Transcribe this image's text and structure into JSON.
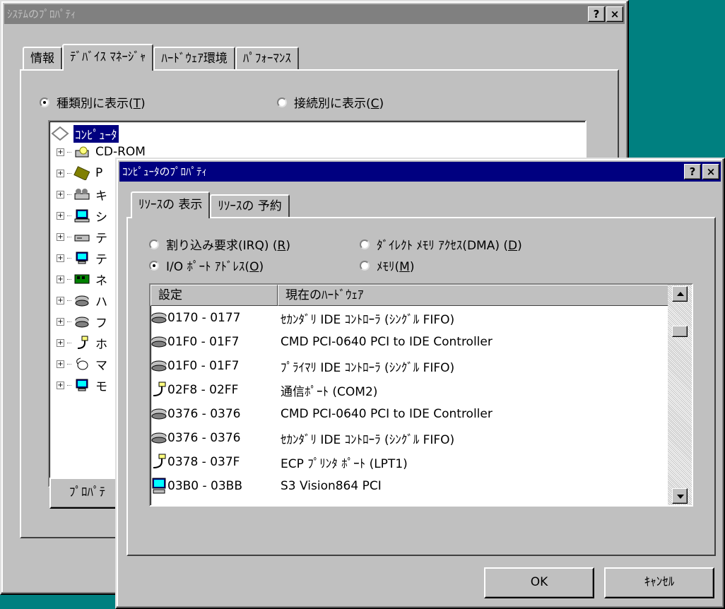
{
  "back_window": {
    "title": "ｼｽﾃﾑのﾌﾟﾛﾊﾟﾃｨ",
    "help_btn": "?",
    "close_btn": "×",
    "tabs": [
      "情報",
      "ﾃﾞﾊﾞｲｽ ﾏﾈｰｼﾞｬ",
      "ﾊｰﾄﾞｳｪｱ環境",
      "ﾊﾟﾌｫｰﾏﾝｽ"
    ],
    "selected_tab": "ﾃﾞﾊﾞｲｽ ﾏﾈｰｼﾞｬ",
    "radio_by_type": {
      "label": "種類別に表示(",
      "key": "T",
      "end": ")",
      "checked": true
    },
    "radio_by_connection": {
      "label": "接続別に表示(",
      "key": "C",
      "end": ")",
      "checked": false
    },
    "tree_root": "ｺﾝﾋﾟｭｰﾀ",
    "tree_items": [
      {
        "label": "CD-ROM",
        "icon": "cdrom-icon"
      },
      {
        "label": "P",
        "icon": "pcmcia-icon"
      },
      {
        "label": "キ",
        "icon": "keyboard-icon"
      },
      {
        "label": "シ",
        "icon": "system-icon"
      },
      {
        "label": "テ",
        "icon": "drive-icon"
      },
      {
        "label": "テ",
        "icon": "display-icon"
      },
      {
        "label": "ネ",
        "icon": "network-icon"
      },
      {
        "label": "ハ",
        "icon": "disk-controller-icon"
      },
      {
        "label": "フ",
        "icon": "floppy-controller-icon"
      },
      {
        "label": "ホ",
        "icon": "port-icon"
      },
      {
        "label": "マ",
        "icon": "mouse-icon"
      },
      {
        "label": "モ",
        "icon": "monitor-icon"
      }
    ],
    "properties_button": "ﾌﾟﾛﾊﾟﾃ"
  },
  "front_window": {
    "title": "ｺﾝﾋﾟｭｰﾀのﾌﾟﾛﾊﾟﾃｨ",
    "help_btn": "?",
    "close_btn": "×",
    "tabs": [
      "ﾘｿｰｽの 表示",
      "ﾘｿｰｽの 予約"
    ],
    "selected_tab": "ﾘｿｰｽの 表示",
    "radios": [
      {
        "label": "割り込み要求(IRQ) (",
        "key": "R",
        "end": ")",
        "checked": false
      },
      {
        "label": "ﾀﾞｲﾚｸﾄ ﾒﾓﾘ ｱｸｾｽ(DMA) (",
        "key": "D",
        "end": ")",
        "checked": false
      },
      {
        "label": "I/O ﾎﾟｰﾄ ｱﾄﾞﾚｽ(",
        "key": "O",
        "end": ")",
        "checked": true
      },
      {
        "label": "ﾒﾓﾘ(",
        "key": "M",
        "end": ")",
        "checked": false
      }
    ],
    "list": {
      "columns": [
        "設定",
        "現在のﾊｰﾄﾞｳｪｱ"
      ],
      "rows": [
        {
          "range": "0170 - 0177",
          "hardware": "ｾｶﾝﾀﾞﾘ IDE ｺﾝﾄﾛｰﾗ (ｼﾝｸﾞﾙ FIFO)",
          "icon": "ide-controller-icon"
        },
        {
          "range": "01F0 - 01F7",
          "hardware": "CMD PCI-0640 PCI to IDE Controller",
          "icon": "ide-controller-icon"
        },
        {
          "range": "01F0 - 01F7",
          "hardware": "ﾌﾟﾗｲﾏﾘ IDE ｺﾝﾄﾛｰﾗ (ｼﾝｸﾞﾙ FIFO)",
          "icon": "ide-controller-icon"
        },
        {
          "range": "02F8 - 02FF",
          "hardware": "通信ﾎﾟｰﾄ (COM2)",
          "icon": "com-port-icon"
        },
        {
          "range": "0376 - 0376",
          "hardware": "CMD PCI-0640 PCI to IDE Controller",
          "icon": "ide-controller-icon"
        },
        {
          "range": "0376 - 0376",
          "hardware": "ｾｶﾝﾀﾞﾘ IDE ｺﾝﾄﾛｰﾗ (ｼﾝｸﾞﾙ FIFO)",
          "icon": "ide-controller-icon"
        },
        {
          "range": "0378 - 037F",
          "hardware": "ECP ﾌﾟﾘﾝﾀ ﾎﾟｰﾄ (LPT1)",
          "icon": "printer-port-icon"
        },
        {
          "range": "03B0 - 03BB",
          "hardware": "S3 Vision864 PCI",
          "icon": "display-adapter-icon"
        }
      ]
    },
    "ok_button": "OK",
    "cancel_button": "ｷｬﾝｾﾙ"
  }
}
